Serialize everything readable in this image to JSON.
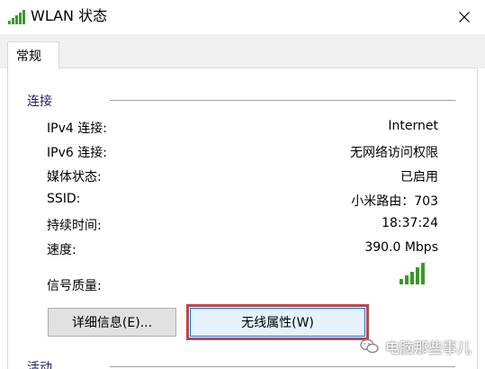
{
  "window": {
    "title": "WLAN 状态",
    "close_glyph": "✕"
  },
  "tabs": [
    {
      "label": "常规",
      "selected": true
    }
  ],
  "connection": {
    "section_title": "连接",
    "rows": [
      {
        "label": "IPv4 连接:",
        "value": "Internet"
      },
      {
        "label": "IPv6 连接:",
        "value": "无网络访问权限"
      },
      {
        "label": "媒体状态:",
        "value": "已启用"
      },
      {
        "label": "SSID:",
        "value": "小米路由：703"
      },
      {
        "label": "持续时间:",
        "value": "18:37:24"
      },
      {
        "label": "速度:",
        "value": "390.0 Mbps"
      }
    ],
    "signal_label": "信号质量:",
    "signal_bars": 5,
    "signal_icon": "signal-strength-icon",
    "signal_color": "#3a9a2a"
  },
  "buttons": {
    "details": "详细信息(E)...",
    "wireless_properties": "无线属性(W)"
  },
  "activity": {
    "section_title": "活动"
  },
  "watermark": {
    "text": "电脑那些事儿",
    "icon": "wechat-icon"
  },
  "colors": {
    "section_title": "#1e1e6a",
    "highlight_outline": "#c0444a",
    "tab_strip_bg": "#f0f0f0",
    "button_bg": "#e1e1e1"
  }
}
